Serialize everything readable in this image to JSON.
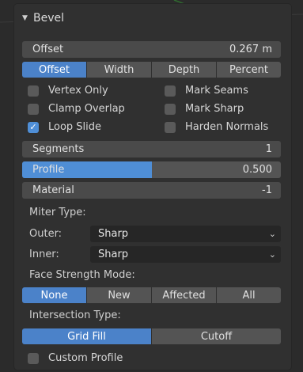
{
  "panel": {
    "title": "Bevel"
  },
  "offset": {
    "label": "Offset",
    "value": "0.267 m"
  },
  "offset_type": {
    "options": [
      "Offset",
      "Width",
      "Depth",
      "Percent"
    ],
    "active": "Offset"
  },
  "checks": {
    "vertex_only": {
      "label": "Vertex Only",
      "checked": false
    },
    "clamp_overlap": {
      "label": "Clamp Overlap",
      "checked": false
    },
    "loop_slide": {
      "label": "Loop Slide",
      "checked": true
    },
    "mark_seams": {
      "label": "Mark Seams",
      "checked": false
    },
    "mark_sharp": {
      "label": "Mark Sharp",
      "checked": false
    },
    "harden_normals": {
      "label": "Harden Normals",
      "checked": false
    }
  },
  "segments": {
    "label": "Segments",
    "value": "1"
  },
  "profile": {
    "label": "Profile",
    "value": "0.500",
    "fraction": 0.5
  },
  "material": {
    "label": "Material",
    "value": "-1"
  },
  "miter": {
    "title": "Miter Type:",
    "outer_label": "Outer:",
    "outer_value": "Sharp",
    "inner_label": "Inner:",
    "inner_value": "Sharp"
  },
  "face_strength": {
    "title": "Face Strength Mode:",
    "options": [
      "None",
      "New",
      "Affected",
      "All"
    ],
    "active": "None"
  },
  "intersection": {
    "title": "Intersection Type:",
    "options": [
      "Grid Fill",
      "Cutoff"
    ],
    "active": "Grid Fill"
  },
  "custom_profile": {
    "label": "Custom Profile",
    "checked": false
  },
  "colors": {
    "accent": "#4f8ed6",
    "panel": "#303030",
    "field": "#545454"
  }
}
